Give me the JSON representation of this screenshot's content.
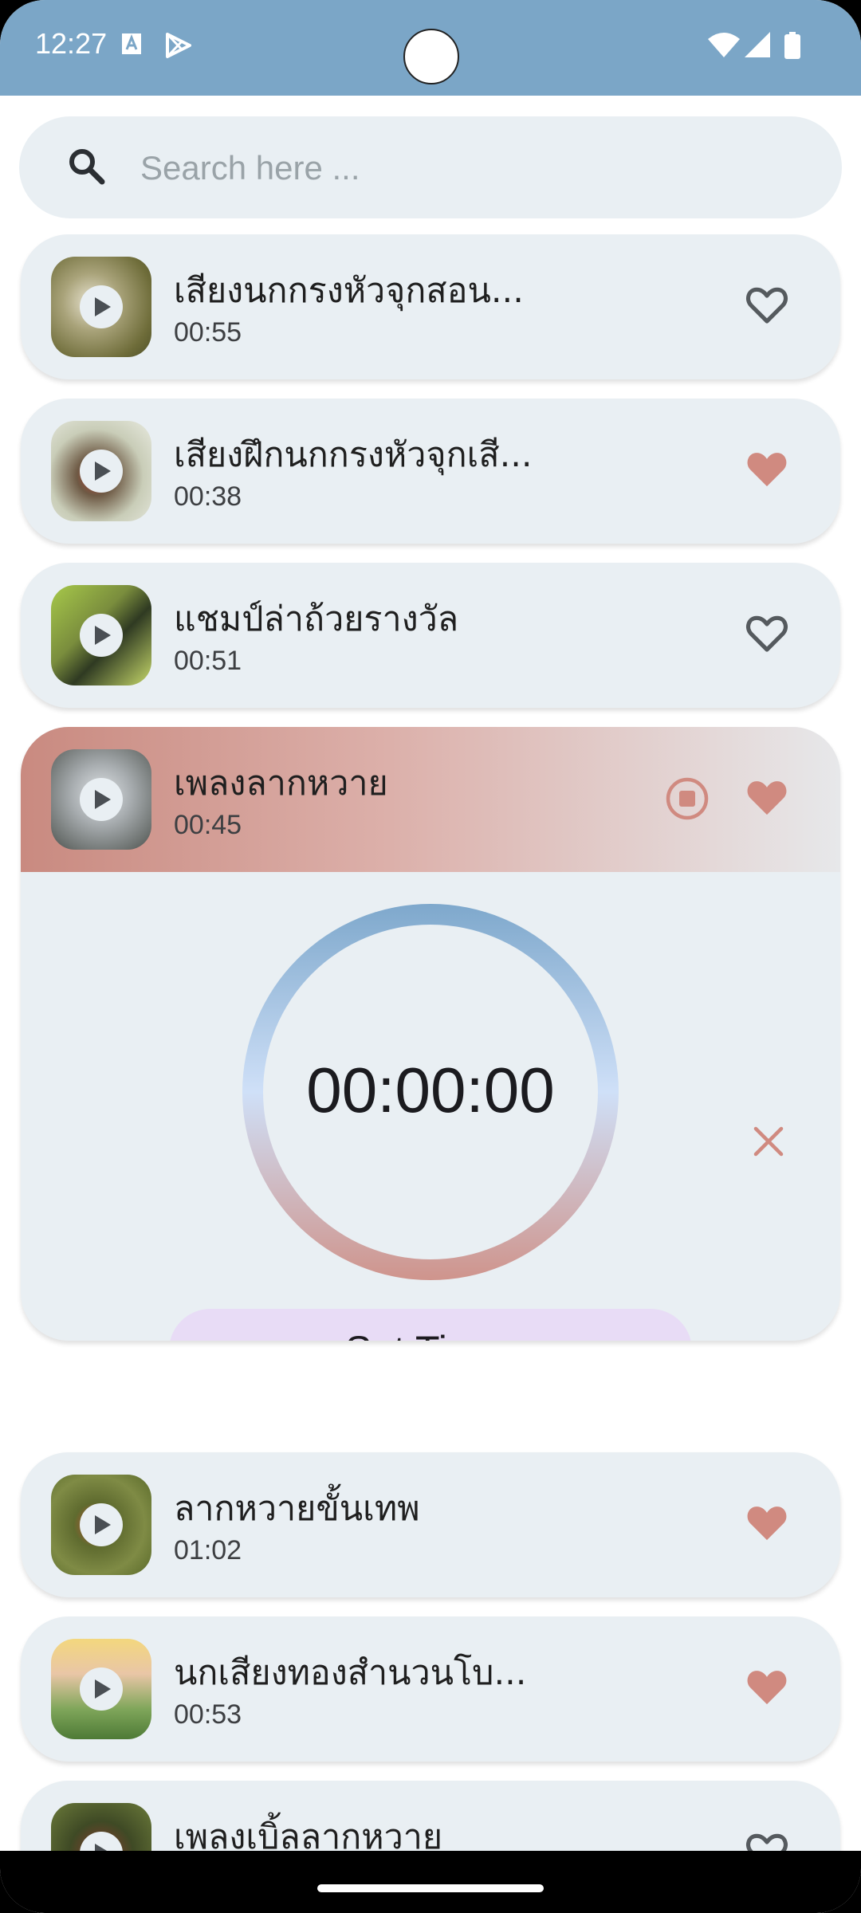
{
  "status_bar": {
    "time": "12:27"
  },
  "search": {
    "placeholder": "Search here ..."
  },
  "songs": [
    {
      "title": "เสียงนกกรงหัวจุกสอน...",
      "duration": "00:55",
      "favorite": false,
      "expanded": false
    },
    {
      "title": "เสียงฝึกนกกรงหัวจุกเสี...",
      "duration": "00:38",
      "favorite": true,
      "expanded": false
    },
    {
      "title": "แชมป์ล่าถ้วยรางวัล",
      "duration": "00:51",
      "favorite": false,
      "expanded": false
    },
    {
      "title": "เพลงลากหวาย",
      "duration": "00:45",
      "favorite": true,
      "expanded": true
    },
    {
      "title": "ลากหวายขั้นเทพ",
      "duration": "01:02",
      "favorite": true,
      "expanded": false
    },
    {
      "title": "นกเสียงทองสำนวนโบ...",
      "duration": "00:53",
      "favorite": true,
      "expanded": false
    },
    {
      "title": "เพลงเบิ้ลลากหวาย",
      "duration": "",
      "favorite": false,
      "expanded": false
    }
  ],
  "timer": {
    "display": "00:00:00",
    "set_label": "Set Timer"
  },
  "colors": {
    "status_bar": "#7ba6c7",
    "card_bg": "#e9eff3",
    "favorite": "#d08a80",
    "outline_heart": "#555a5e",
    "set_timer_bg": "#e8dcf6"
  }
}
